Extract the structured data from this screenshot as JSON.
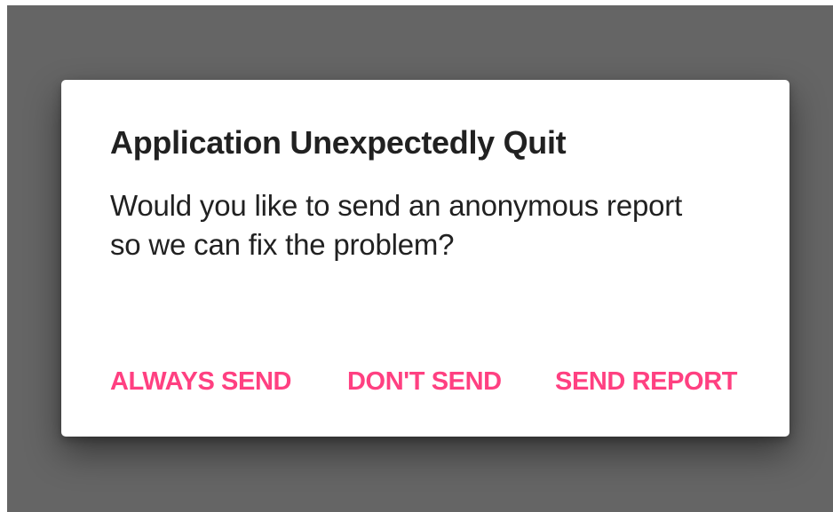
{
  "dialog": {
    "title": "Application Unexpectedly Quit",
    "message": "Would you like to send an anonymous report so we can fix the problem?",
    "buttons": {
      "always_send": "ALWAYS SEND",
      "dont_send": "DON'T SEND",
      "send_report": "SEND REPORT"
    }
  },
  "colors": {
    "accent": "#ff4081",
    "scrim": "#656565",
    "dialog_background": "#ffffff",
    "text_primary": "#212121"
  }
}
